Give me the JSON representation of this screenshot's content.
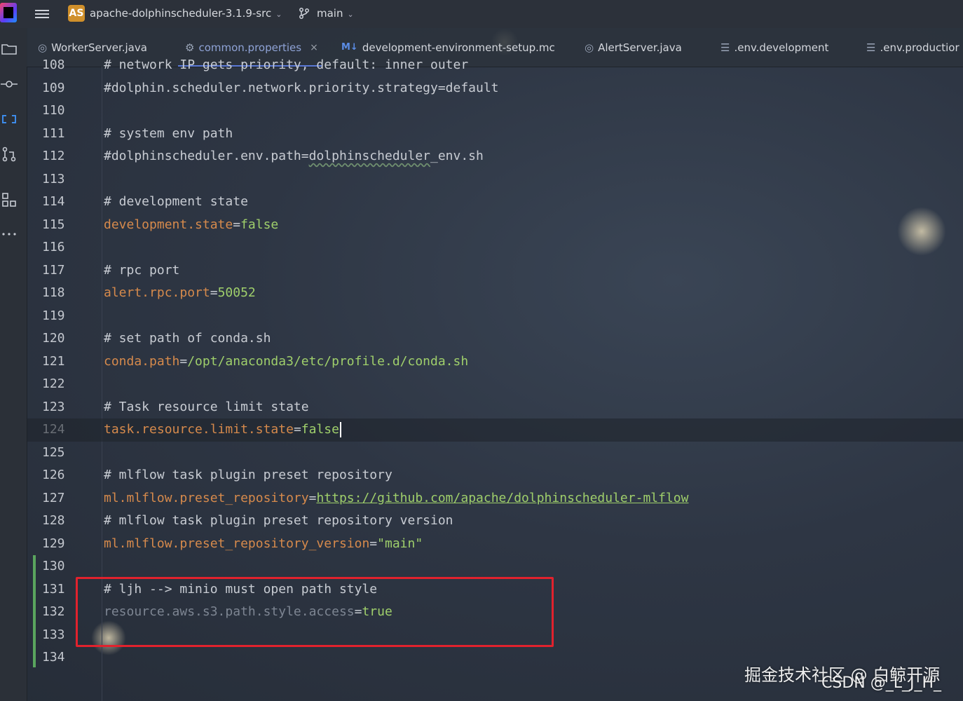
{
  "titlebar": {
    "project_badge": "AS",
    "project_name": "apache-dolphinscheduler-3.1.9-src",
    "branch": "main",
    "chevron": "⌄"
  },
  "tabs": [
    {
      "label": "WorkerServer.java",
      "icon": "java-class-icon"
    },
    {
      "label": "common.properties",
      "icon": "gear-icon",
      "active": true,
      "close": "×"
    },
    {
      "label": "development-environment-setup.mc",
      "icon": "markdown-icon",
      "icon_text": "M↓"
    },
    {
      "label": "AlertServer.java",
      "icon": "java-class-icon"
    },
    {
      "label": ".env.development",
      "icon": "text-file-icon"
    },
    {
      "label": ".env.productior",
      "icon": "text-file-icon"
    }
  ],
  "gutter": {
    "line_numbers": [
      "108",
      "109",
      "110",
      "111",
      "112",
      "113",
      "114",
      "115",
      "116",
      "117",
      "118",
      "119",
      "120",
      "121",
      "122",
      "123",
      "124",
      "125",
      "126",
      "127",
      "128",
      "129",
      "130",
      "131",
      "132",
      "133",
      "134"
    ]
  },
  "code": {
    "l108": "# network IP gets priority, default: inner outer",
    "l109": "#dolphin.scheduler.network.priority.strategy=default",
    "l111": "# system env path",
    "l112_a": "#dolphinscheduler.env.path=",
    "l112_b": "dolphinscheduler",
    "l112_c": "_env.sh",
    "l114": "# development state",
    "l115_key": "development.state",
    "l115_val": "false",
    "l117": "# rpc port",
    "l118_key": "alert.rpc.port",
    "l118_val": "50052",
    "l120": "# set path of conda.sh",
    "l121_key": "conda.path",
    "l121_val": "/opt/anaconda3/etc/profile.d/conda.sh",
    "l123": "# Task resource limit state",
    "l124_key": "task.resource.limit.state",
    "l124_val": "false",
    "l126": "# mlflow task plugin preset repository",
    "l127_key": "ml.mlflow.preset_repository",
    "l127_val": "https://github.com/apache/dolphinscheduler-mlflow",
    "l128": "# mlflow task plugin preset repository version",
    "l129_key": "ml.mlflow.preset_repository_version",
    "l129_val": "\"main\"",
    "l131": "# ljh --> minio must open path style",
    "l132_key": "resource.aws.s3.path.style.access",
    "l132_val": "true",
    "eq": "="
  },
  "watermarks": {
    "juejin": "掘金技术社区 @ 白鲸开源",
    "csdn": "CSDN @_L_J_H_"
  },
  "colors": {
    "key": "#d68a4c",
    "value": "#9fcf6b",
    "comment": "#c8ccd3",
    "highlight_border": "#e1222d",
    "git_added": "#5aa55e",
    "active_tab": "#8fa3d6"
  }
}
